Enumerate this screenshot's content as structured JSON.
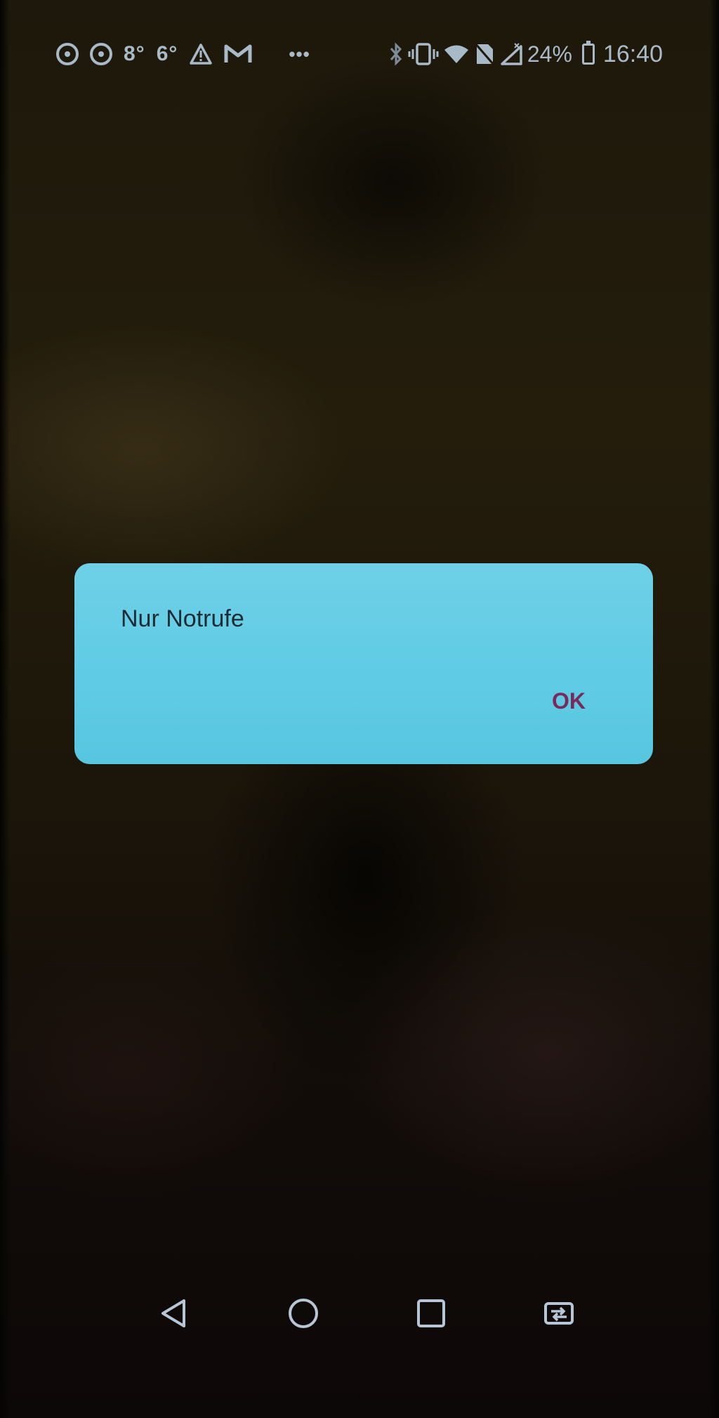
{
  "status_bar": {
    "left_icons": [
      "sync-icon",
      "sync-icon"
    ],
    "temp_1": "8°",
    "temp_2": "6°",
    "warning_icon": "warning-icon",
    "mail_icon": "gmail-icon",
    "more": "•••",
    "right_icons": [
      "bluetooth-icon",
      "vibrate-icon",
      "wifi-icon",
      "no-sim-icon",
      "signal-icon"
    ],
    "battery_percent": "24%",
    "time": "16:40"
  },
  "dialog": {
    "message": "Nur Notrufe",
    "ok_label": "OK",
    "background_color": "#61cce5",
    "button_color": "#7a2a5a"
  },
  "nav_bar": {
    "buttons": [
      "back-icon",
      "home-icon",
      "recents-icon",
      "switch-app-icon"
    ]
  }
}
